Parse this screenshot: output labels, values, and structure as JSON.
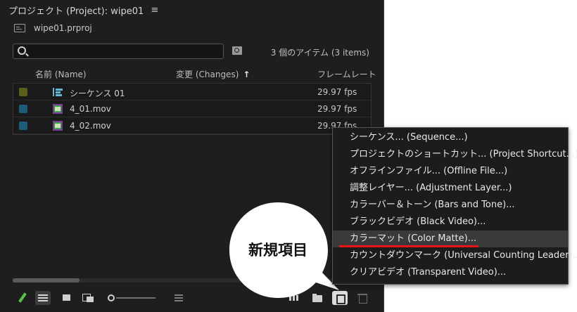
{
  "panel": {
    "title": "プロジェクト (Project): wipe01",
    "menu_icon": "≡",
    "project_file": "wipe01.prproj",
    "search": {
      "value": "",
      "placeholder": ""
    },
    "item_count": "3 個のアイテム (3 items)"
  },
  "columns": {
    "name": "名前 (Name)",
    "changes": "変更 (Changes)",
    "sort_arrow": "↑",
    "frame_rate": "フレームレート"
  },
  "items": [
    {
      "name": "シーケンス 01",
      "fps": "29.97 fps",
      "label_color": "#5b5f1e",
      "icon": "sequence-icon"
    },
    {
      "name": "4_01.mov",
      "fps": "29.97 fps",
      "label_color": "#1f5c7a",
      "icon": "video-clip-icon"
    },
    {
      "name": "4_02.mov",
      "fps": "29.97 fps",
      "label_color": "#1f5c7a",
      "icon": "video-clip-icon"
    }
  ],
  "toolbar": {
    "icons": [
      "pencil-icon",
      "list-view-icon",
      "icon-view-icon",
      "freeform-view-icon",
      "zoom-slider",
      "sort-icon",
      "automate-to-sequence-icon",
      "new-bin-icon",
      "new-item-icon",
      "trash-icon"
    ]
  },
  "callout": {
    "text": "新規項目"
  },
  "context_menu": {
    "items": [
      "シーケンス... (Sequence...)",
      "プロジェクトのショートカット... (Project Shortcut...)",
      "オフラインファイル... (Offline File...)",
      "調整レイヤー... (Adjustment Layer...)",
      "カラーバー＆トーン (Bars and Tone)...",
      "ブラックビデオ (Black Video)...",
      "カラーマット (Color Matte)...",
      "カウントダウンマーク (Universal Counting Leader)...",
      "クリアビデオ (Transparent Video)..."
    ],
    "highlighted_index": 6,
    "underline_color": "#e8141a"
  }
}
